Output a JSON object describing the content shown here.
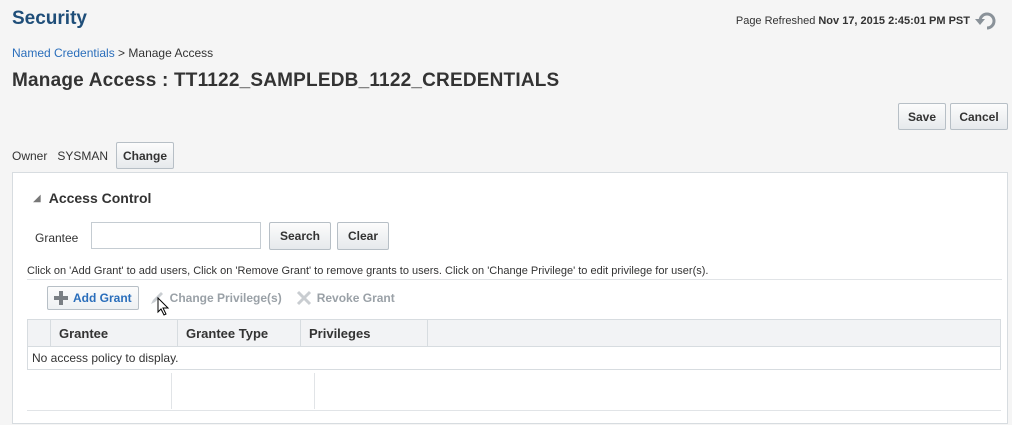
{
  "header": {
    "app_title": "Security",
    "refresh_label": "Page Refreshed",
    "refresh_timestamp": "Nov 17, 2015 2:45:01 PM PST"
  },
  "breadcrumb": {
    "link": "Named Credentials",
    "separator": " > ",
    "current": "Manage Access"
  },
  "page_title": "Manage Access : TT1122_SAMPLEDB_1122_CREDENTIALS",
  "actions": {
    "save_label": "Save",
    "cancel_label": "Cancel"
  },
  "owner": {
    "label": "Owner",
    "value": "SYSMAN",
    "change_label": "Change"
  },
  "access_control": {
    "title": "Access Control",
    "grantee_label": "Grantee",
    "grantee_value": "",
    "search_label": "Search",
    "clear_label": "Clear",
    "instructions": "Click on 'Add Grant' to add users, Click on 'Remove Grant' to remove grants to users. Click on 'Change Privilege' to edit privilege for user(s).",
    "toolbar": {
      "add_grant": "Add Grant",
      "change_privileges": "Change Privilege(s)",
      "revoke_grant": "Revoke Grant"
    },
    "table": {
      "columns": [
        "Grantee",
        "Grantee Type",
        "Privileges"
      ],
      "empty_message": "No access policy to display."
    }
  },
  "icons": {
    "refresh": "refresh-icon",
    "add": "plus-icon",
    "edit": "pencil-icon",
    "revoke": "x-icon",
    "collapse": "triangle-down-icon"
  },
  "colors": {
    "title": "#1f4e79",
    "link": "#2a6ebb",
    "accent_green": "#6e9a3a"
  }
}
